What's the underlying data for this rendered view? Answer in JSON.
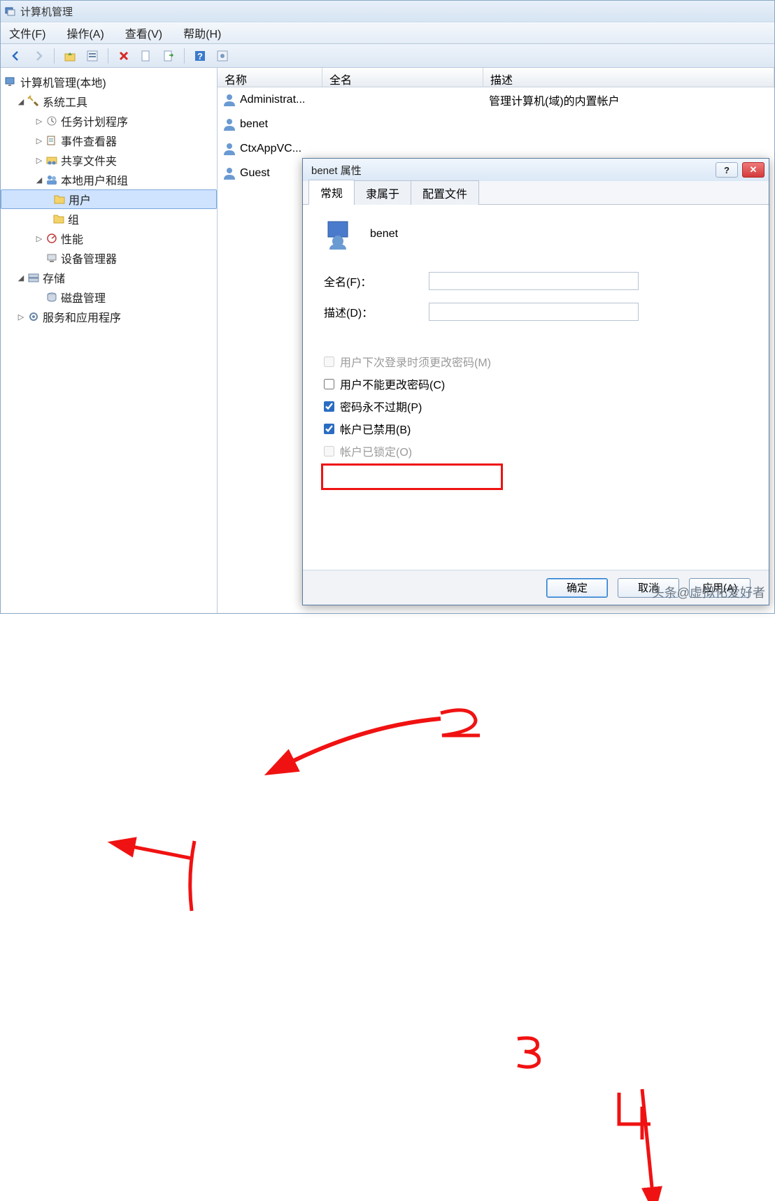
{
  "window": {
    "title": "计算机管理"
  },
  "menu": {
    "file": "文件(F)",
    "action": "操作(A)",
    "view": "查看(V)",
    "help": "帮助(H)"
  },
  "tree": {
    "root": "计算机管理(本地)",
    "system_tools": "系统工具",
    "task_scheduler": "任务计划程序",
    "event_viewer": "事件查看器",
    "shared_folders": "共享文件夹",
    "local_users_groups": "本地用户和组",
    "users": "用户",
    "groups": "组",
    "performance": "性能",
    "device_manager": "设备管理器",
    "storage": "存储",
    "disk_management": "磁盘管理",
    "services_apps": "服务和应用程序"
  },
  "list": {
    "headers": {
      "name": "名称",
      "fullname": "全名",
      "description": "描述"
    },
    "rows": [
      {
        "name": "Administrat...",
        "desc": "管理计算机(域)的内置帐户"
      },
      {
        "name": "benet",
        "desc": ""
      },
      {
        "name": "CtxAppVC...",
        "desc": ""
      },
      {
        "name": "Guest",
        "desc": ""
      }
    ]
  },
  "dialog": {
    "title": "benet 属性",
    "tabs": {
      "general": "常规",
      "member_of": "隶属于",
      "profile": "配置文件"
    },
    "username": "benet",
    "fullname_label": "全名(F)：",
    "description_label": "描述(D)：",
    "fullname_value": "",
    "description_value": "",
    "chk_must_change": "用户下次登录时须更改密码(M)",
    "chk_cannot_change": "用户不能更改密码(C)",
    "chk_never_expire": "密码永不过期(P)",
    "chk_disabled": "帐户已禁用(B)",
    "chk_locked": "帐户已锁定(O)",
    "ok": "确定",
    "cancel": "取消",
    "apply": "应用(A)"
  },
  "watermark": "头条@虚拟化爱好者"
}
